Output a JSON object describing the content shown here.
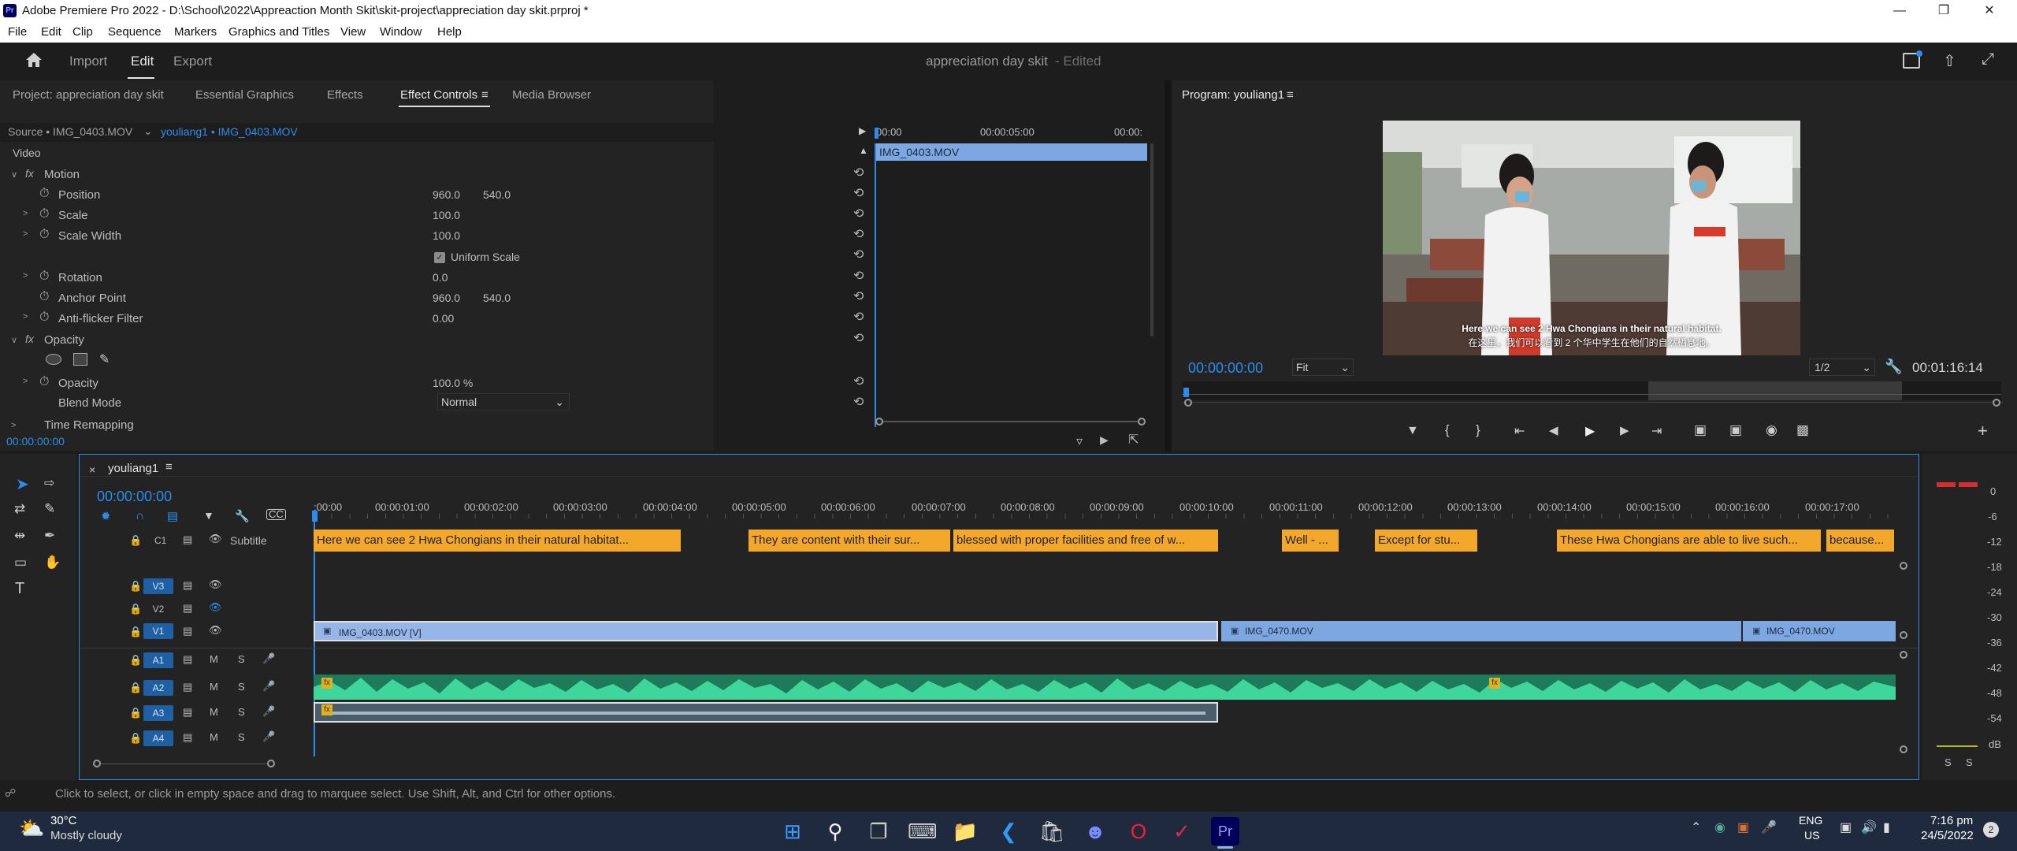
{
  "window": {
    "title": "Adobe Premiere Pro 2022 - D:\\School\\2022\\Appreaction Month Skit\\skit-project\\appreciation day skit.prproj *",
    "app_icon": "Pr"
  },
  "menu": [
    "File",
    "Edit",
    "Clip",
    "Sequence",
    "Markers",
    "Graphics and Titles",
    "View",
    "Window",
    "Help"
  ],
  "header": {
    "nav": [
      "Import",
      "Edit",
      "Export"
    ],
    "active": "Edit",
    "project_title": "appreciation day skit",
    "status": "- Edited"
  },
  "left_tabs": [
    "Project: appreciation day skit",
    "Essential Graphics",
    "Effects",
    "Effect Controls",
    "Media Browser"
  ],
  "left_active": "Effect Controls",
  "effect_controls": {
    "source": "Source • IMG_0403.MOV",
    "sequence": "youliang1 • IMG_0403.MOV",
    "section": "Video",
    "ruler": [
      "00:00",
      "00:00:05:00",
      "00:00:"
    ],
    "clip_label": "IMG_0403.MOV",
    "motion": "Motion",
    "position_label": "Position",
    "position_x": "960.0",
    "position_y": "540.0",
    "scale_label": "Scale",
    "scale_val": "100.0",
    "scale_width_label": "Scale Width",
    "scale_width_val": "100.0",
    "uniform_scale": "Uniform Scale",
    "rotation_label": "Rotation",
    "rotation_val": "0.0",
    "anchor_label": "Anchor Point",
    "anchor_x": "960.0",
    "anchor_y": "540.0",
    "flicker_label": "Anti-flicker Filter",
    "flicker_val": "0.00",
    "opacity_section": "Opacity",
    "opacity_label": "Opacity",
    "opacity_val": "100.0 %",
    "blend_label": "Blend Mode",
    "blend_val": "Normal",
    "time_remap": "Time Remapping",
    "timecode": "00:00:00:00"
  },
  "program": {
    "title": "Program: youliang1",
    "subtitle_en": "Here we can see 2 Hwa Chongians in their natural habitat.",
    "subtitle_zh": "在这里，我们可以看到 2 个华中学生在他们的自然栖息地。",
    "timecode": "00:00:00:00",
    "zoom": "Fit",
    "resolution": "1/2",
    "duration": "00:01:16:14"
  },
  "timeline": {
    "sequence": "youliang1",
    "timecode": "00:00:00:00",
    "ticks": [
      ":00:00",
      "00:00:01:00",
      "00:00:02:00",
      "00:00:03:00",
      "00:00:04:00",
      "00:00:05:00",
      "00:00:06:00",
      "00:00:07:00",
      "00:00:08:00",
      "00:00:09:00",
      "00:00:10:00",
      "00:00:11:00",
      "00:00:12:00",
      "00:00:13:00",
      "00:00:14:00",
      "00:00:15:00",
      "00:00:16:00",
      "00:00:17:00"
    ],
    "caption_track": {
      "label": "C1",
      "name": "Subtitle"
    },
    "captions": [
      "Here we can see 2 Hwa Chongians in their natural habitat...",
      "They are content with their sur...",
      "blessed with proper facilities and free of w...",
      "Well - ...",
      "Except for stu...",
      "These Hwa Chongians are able to live such...",
      "because..."
    ],
    "video_tracks": [
      "V3",
      "V2",
      "V1"
    ],
    "audio_tracks": [
      "A1",
      "A2",
      "A3",
      "A4"
    ],
    "mute": "M",
    "solo": "S",
    "clips": [
      "IMG_0403.MOV [V]",
      "IMG_0470.MOV",
      "IMG_0470.MOV"
    ]
  },
  "meter": {
    "scale": [
      "0",
      "-6",
      "-12",
      "-18",
      "-24",
      "-30",
      "-36",
      "-42",
      "-48",
      "-54",
      "dB"
    ],
    "solo": [
      "S",
      "S"
    ]
  },
  "status_bar": "Click to select, or click in empty space and drag to marquee select. Use Shift, Alt, and Ctrl for other options.",
  "taskbar": {
    "temp": "30°C",
    "weather": "Mostly cloudy",
    "lang1": "ENG",
    "lang2": "US",
    "time": "7:16 pm",
    "date": "24/5/2022",
    "notif": "2"
  }
}
